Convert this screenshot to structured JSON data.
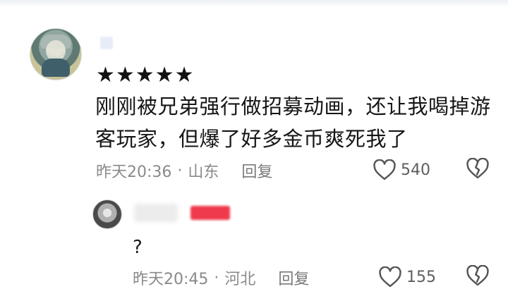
{
  "comment": {
    "stars": "★★★★★",
    "text": "刚刚被兄弟强行做招募动画，还让我喝掉游客玩家，但爆了好多金币爽死我了",
    "time": "昨天20:36",
    "separator": "·",
    "location": "山东",
    "reply_label": "回复",
    "like_count": "540",
    "icons": {
      "like": "heart-icon",
      "dislike": "broken-heart-icon"
    }
  },
  "reply": {
    "text": "?",
    "time": "昨天20:45",
    "separator": "·",
    "location": "河北",
    "reply_label": "回复",
    "like_count": "155",
    "badge_color": "#ef3a4d"
  }
}
